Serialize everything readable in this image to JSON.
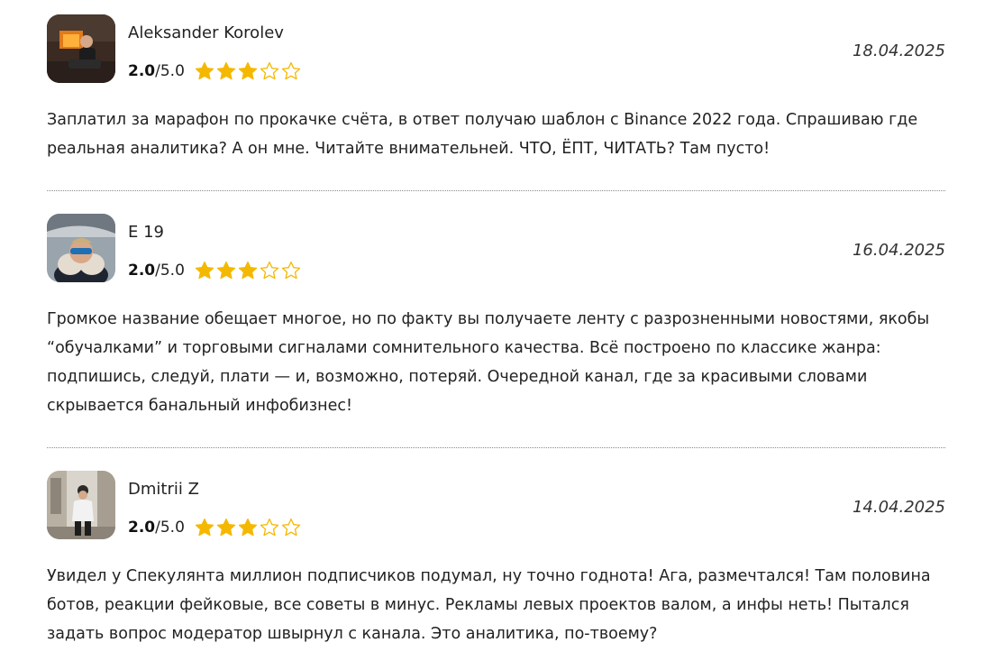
{
  "reviews": [
    {
      "author": "Aleksander Korolev",
      "rating_score": "2.0",
      "rating_max": "/5.0",
      "stars_filled": 3,
      "stars_total": 5,
      "date": "18.04.2025",
      "text": "Заплатил за марафон по прокачке счёта, в ответ получаю шаблон с Binance 2022 года. Спрашиваю где реальная аналитика? А он мне. Читайте внимательней. ЧТО, ЁПТ, ЧИТАТЬ? Там пусто!"
    },
    {
      "author": "E 19",
      "rating_score": "2.0",
      "rating_max": "/5.0",
      "stars_filled": 3,
      "stars_total": 5,
      "date": "16.04.2025",
      "text": "Громкое название обещает многое, но по факту вы получаете ленту с разрозненными новостями, якобы “обучалками” и торговыми сигналами сомнительного качества. Всё построено по классике жанра: подпишись, следуй, плати — и, возможно, потеряй. Очередной канал, где за красивыми словами скрывается банальный инфобизнес!"
    },
    {
      "author": "Dmitrii Z",
      "rating_score": "2.0",
      "rating_max": "/5.0",
      "stars_filled": 3,
      "stars_total": 5,
      "date": "14.04.2025",
      "text": "Увидел у Спекулянта миллион подписчиков подумал, ну точно годнота! Ага, размечтался! Там половина ботов, реакции фейковые, все советы в минус. Рекламы левых проектов валом, а инфы неть! Пытался задать вопрос модератор швырнул с канала. Это аналитика, по-твоему?"
    }
  ],
  "colors": {
    "star_filled": "#F5B800",
    "star_empty_outline": "#F5B800",
    "divider": "#8a8a8a",
    "text": "#222222"
  },
  "icons": {
    "star_filled": "star-filled-icon",
    "star_empty": "star-outline-icon"
  }
}
